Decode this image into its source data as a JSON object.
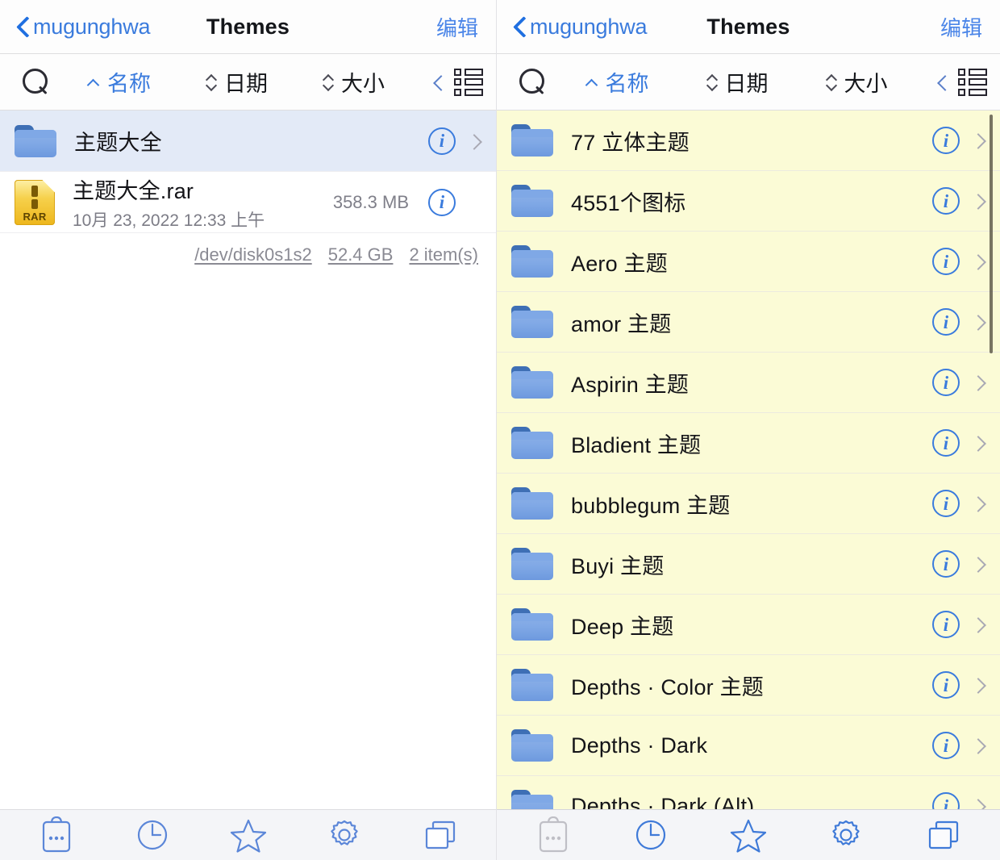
{
  "theme": {
    "accent_blue": "#3a7bdd",
    "nav_link_blue": "#4a85e8",
    "left_list_bg": "#ffffff",
    "right_list_bg": "#fbfbd6",
    "selected_row_bg": "#e3eaf7",
    "toolbar_bg": "#f4f5f8",
    "folder_blue": "#7ea7e5",
    "rar_gold": "#f6d14c"
  },
  "left_pane": {
    "navbar": {
      "back_label": "mugunghwa",
      "back_icon": "chevron-left-icon",
      "title": "Themes",
      "edit_label": "编辑"
    },
    "sortbar": {
      "search_icon": "search-icon",
      "sort_options": [
        {
          "label": "名称",
          "state": "asc",
          "active": true
        },
        {
          "label": "日期",
          "state": "none",
          "active": false
        },
        {
          "label": "大小",
          "state": "none",
          "active": false
        }
      ],
      "collapse_icon": "chevron-left-icon",
      "view_icon": "list-view-icon"
    },
    "items": [
      {
        "name": "主题大全",
        "icon": "folder-icon",
        "kind": "folder",
        "selected": true,
        "subtitle": "",
        "size": "",
        "has_chevron": true
      },
      {
        "name": "主题大全.rar",
        "icon": "rar-file-icon",
        "icon_label": "RAR",
        "kind": "file",
        "selected": false,
        "subtitle": "10月 23, 2022 12:33 上午",
        "size": "358.3 MB",
        "has_chevron": false
      }
    ],
    "disk_info": {
      "device": "/dev/disk0s1s2",
      "capacity": "52.4 GB",
      "count": "2 item(s)"
    }
  },
  "right_pane": {
    "navbar": {
      "back_label": "mugunghwa",
      "back_icon": "chevron-left-icon",
      "title": "Themes",
      "edit_label": "编辑"
    },
    "sortbar": {
      "search_icon": "search-icon",
      "sort_options": [
        {
          "label": "名称",
          "state": "asc",
          "active": true
        },
        {
          "label": "日期",
          "state": "none",
          "active": false
        },
        {
          "label": "大小",
          "state": "none",
          "active": false
        }
      ],
      "collapse_icon": "chevron-left-icon",
      "view_icon": "list-view-icon"
    },
    "items": [
      {
        "name": "77 立体主题",
        "icon": "folder-icon",
        "kind": "folder"
      },
      {
        "name": "4551个图标",
        "icon": "folder-icon",
        "kind": "folder"
      },
      {
        "name": "Aero 主题",
        "icon": "folder-icon",
        "kind": "folder"
      },
      {
        "name": "amor 主题",
        "icon": "folder-icon",
        "kind": "folder"
      },
      {
        "name": "Aspirin 主题",
        "icon": "folder-icon",
        "kind": "folder"
      },
      {
        "name": "Bladient 主题",
        "icon": "folder-icon",
        "kind": "folder"
      },
      {
        "name": "bubblegum 主题",
        "icon": "folder-icon",
        "kind": "folder"
      },
      {
        "name": "Buyi 主题",
        "icon": "folder-icon",
        "kind": "folder"
      },
      {
        "name": "Deep 主题",
        "icon": "folder-icon",
        "kind": "folder"
      },
      {
        "name": "Depths · Color 主题",
        "icon": "folder-icon",
        "kind": "folder"
      },
      {
        "name": "Depths · Dark",
        "icon": "folder-icon",
        "kind": "folder"
      },
      {
        "name": "Depths · Dark (Alt)",
        "icon": "folder-icon",
        "kind": "folder"
      }
    ],
    "scrollbar_visible": true
  },
  "toolbars": {
    "left": [
      {
        "icon": "clipboard-icon",
        "enabled": true
      },
      {
        "icon": "clock-icon",
        "enabled": true
      },
      {
        "icon": "star-icon",
        "enabled": true
      },
      {
        "icon": "gear-icon",
        "enabled": true
      },
      {
        "icon": "windows-icon",
        "enabled": true
      }
    ],
    "right": [
      {
        "icon": "clipboard-icon",
        "enabled": false
      },
      {
        "icon": "clock-icon",
        "enabled": true
      },
      {
        "icon": "star-icon",
        "enabled": true
      },
      {
        "icon": "gear-icon",
        "enabled": true
      },
      {
        "icon": "windows-icon",
        "enabled": true
      }
    ]
  }
}
